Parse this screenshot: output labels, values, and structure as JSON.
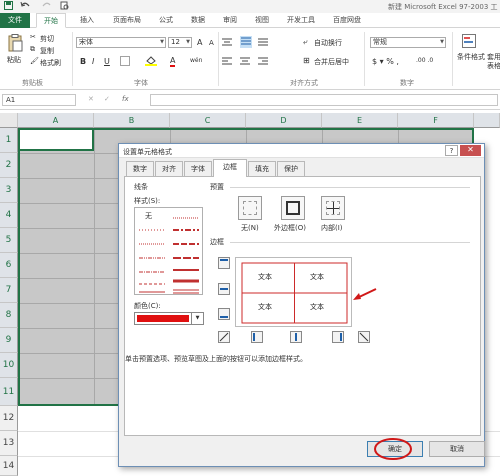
{
  "titlebar": {
    "title": "新建 Microsoft Excel 97-2003 工",
    "quick_access": [
      "save-icon",
      "undo-icon",
      "redo-icon",
      "print-preview-icon"
    ]
  },
  "ribbon_tabs": [
    "文件",
    "开始",
    "插入",
    "页面布局",
    "公式",
    "数据",
    "审阅",
    "视图",
    "开发工具",
    "百度网盘"
  ],
  "ribbon": {
    "clipboard": {
      "paste": "粘贴",
      "cut": "剪切",
      "copy": "复制",
      "format_painter": "格式刷",
      "label": "剪贴板"
    },
    "font": {
      "name": "宋体",
      "size": "12",
      "bold": "B",
      "italic": "I",
      "underline": "U",
      "grow": "A",
      "shrink": "A",
      "font_color": "A",
      "phonetic": "wén",
      "label": "字体"
    },
    "alignment": {
      "wrap": "自动换行",
      "merge": "合并后居中",
      "label": "对齐方式"
    },
    "number": {
      "format": "常规",
      "label": "数字"
    },
    "styles": {
      "conditional": "条件格式",
      "table": "套用",
      "table2": "表格"
    }
  },
  "formula_bar": {
    "name_box": "A1",
    "fx": "fx"
  },
  "grid": {
    "columns": [
      "A",
      "B",
      "C",
      "D",
      "E",
      "F"
    ],
    "rows": [
      "1",
      "2",
      "3",
      "4",
      "5",
      "6",
      "7",
      "8",
      "9",
      "10",
      "11",
      "12",
      "13",
      "14"
    ]
  },
  "dialog": {
    "title": "设置单元格格式",
    "help": "?",
    "close": "✕",
    "tabs": [
      "数字",
      "对齐",
      "字体",
      "边框",
      "填充",
      "保护"
    ],
    "active_tab": "边框",
    "line_section": "线条",
    "style_label": "样式(S):",
    "style_none": "无",
    "color_label": "颜色(C):",
    "line_color": "#e01010",
    "preset_label": "预置",
    "presets": [
      "无(N)",
      "外边框(O)",
      "内部(I)"
    ],
    "border_label": "边框",
    "preview_text": [
      "文本",
      "文本",
      "文本",
      "文本"
    ],
    "hint": "单击预置选项、预览草图及上面的按钮可以添加边框样式。",
    "ok": "确定",
    "cancel": "取消"
  },
  "colors": {
    "excel_green": "#217346",
    "border_red": "#cc2a2a"
  }
}
